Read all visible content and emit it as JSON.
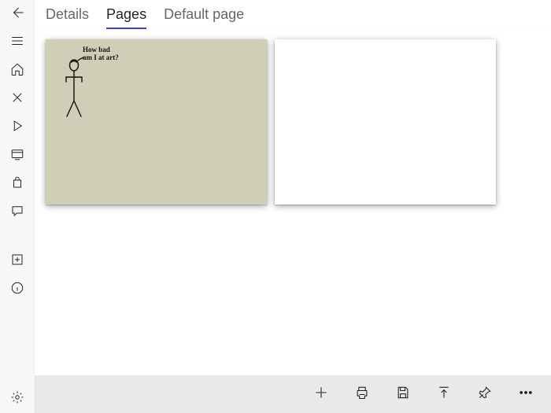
{
  "tabs": {
    "details": "Details",
    "pages": "Pages",
    "default_page": "Default page",
    "active": "pages"
  },
  "pages": {
    "thumb1_text_line1": "How bad",
    "thumb1_text_line2": "am I at art?"
  },
  "sidebar": {
    "back": "back-icon",
    "menu": "menu-icon",
    "home": "home-icon",
    "shuffle": "shuffle-icon",
    "play": "play-icon",
    "screen": "screen-icon",
    "box": "box-icon",
    "chat": "chat-icon",
    "add_sq": "add-square-icon",
    "info": "info-icon",
    "settings": "settings-icon"
  },
  "toolbar": {
    "add": "add-icon",
    "print": "print-icon",
    "save": "save-icon",
    "export": "export-up-icon",
    "pin": "pin-icon",
    "more": "more-icon"
  }
}
